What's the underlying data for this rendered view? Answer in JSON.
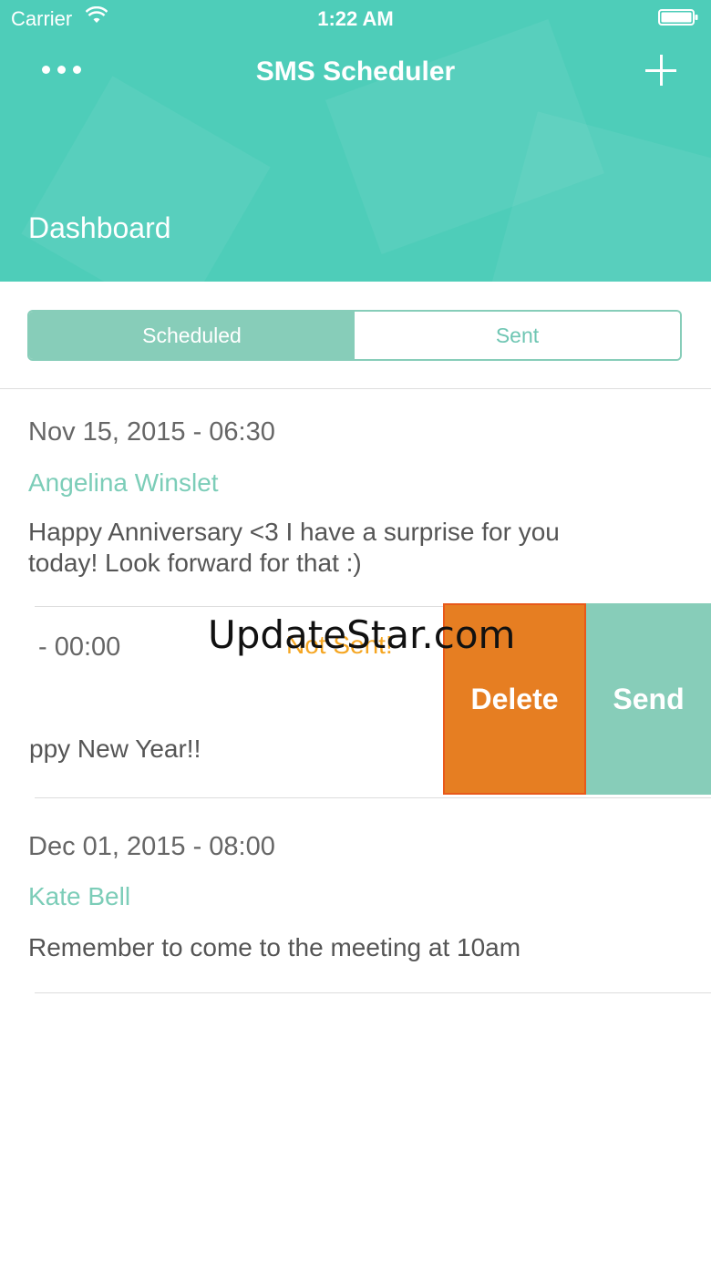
{
  "status_bar": {
    "carrier": "Carrier",
    "time": "1:22 AM"
  },
  "nav": {
    "title": "SMS Scheduler"
  },
  "header": {
    "section_title": "Dashboard"
  },
  "tabs": [
    {
      "label": "Scheduled",
      "selected": true
    },
    {
      "label": "Sent",
      "selected": false
    }
  ],
  "messages": [
    {
      "date": "Nov 15, 2015 - 06:30",
      "recipient": "Angelina Winslet",
      "body_line1": "Happy Anniversary <3 I have a surprise for you",
      "body_line2": "today! Look forward for that :)"
    },
    {
      "date_partial": "- 00:00",
      "status": "Not Sent!",
      "body_partial": "ppy New Year!!"
    },
    {
      "date": "Dec 01, 2015 - 08:00",
      "recipient": "Kate Bell",
      "body_line1": "Remember to come to the meeting at 10am"
    }
  ],
  "swipe_actions": {
    "delete_label": "Delete",
    "send_label": "Send"
  },
  "watermark": "UpdateStar.com",
  "colors": {
    "header_teal": "#4ecdb9",
    "accent_teal": "#87cdb9",
    "delete_orange": "#e67e22",
    "status_orange": "#f5a623"
  }
}
